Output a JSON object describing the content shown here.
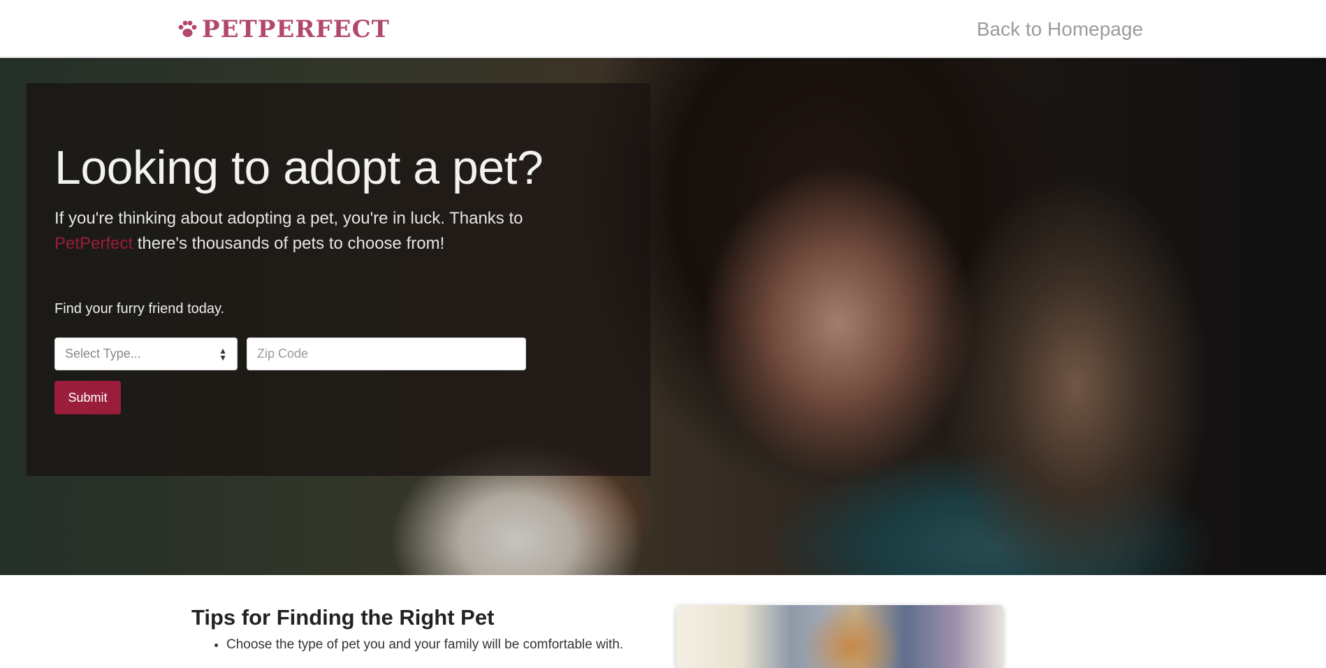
{
  "nav": {
    "brand": "PetPerfect",
    "back_link": "Back to Homepage"
  },
  "hero": {
    "headline": "Looking to adopt a pet?",
    "intro_before": "If you're thinking about adopting a pet, you're in luck. Thanks to ",
    "intro_brand": "PetPerfect",
    "intro_after": " there's thousands of pets to choose from!",
    "find_label": "Find your furry friend today.",
    "select_placeholder": "Select Type...",
    "zip_placeholder": "Zip Code",
    "submit_label": "Submit"
  },
  "tips": {
    "title": "Tips for Finding the Right Pet",
    "items": [
      "Choose the type of pet you and your family will be comfortable with."
    ]
  },
  "colors": {
    "brand": "#b2476d",
    "accent": "#9a1d3c"
  },
  "icons": {
    "logo": "paw-icon",
    "select": "sort-arrows-icon"
  }
}
